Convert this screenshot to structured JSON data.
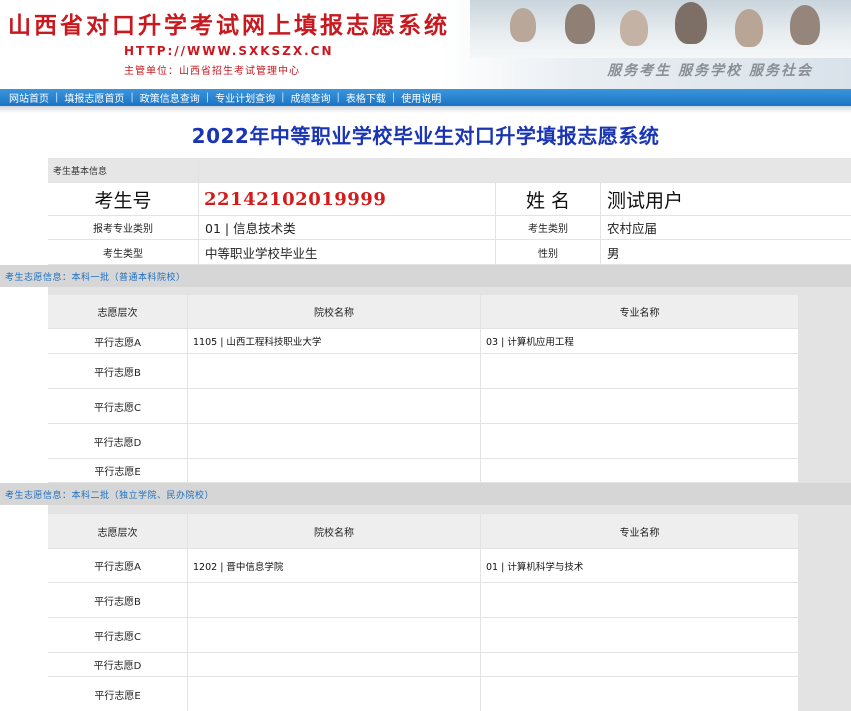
{
  "header": {
    "site_title": "山西省对口升学考试网上填报志愿系统",
    "url": "HTTP://WWW.SXKSZX.CN",
    "org": "主管单位：山西省招生考试管理中心",
    "slogan": "服务考生  服务学校  服务社会"
  },
  "nav": {
    "items": [
      "网站首页",
      "填报志愿首页",
      "政策信息查询",
      "专业计划查询",
      "成绩查询",
      "表格下载",
      "使用说明"
    ]
  },
  "page_title": "2022年中等职业学校毕业生对口升学填报志愿系统",
  "basic_info": {
    "section_label": "考生基本信息",
    "exam_no_label": "考生号",
    "exam_no": "22142102019999",
    "name_label": "姓 名",
    "name": "测试用户",
    "major_cat_label": "报考专业类别",
    "major_cat": "01 | 信息技术类",
    "student_cat_label": "考生类别",
    "student_cat": "农村应届",
    "student_type_label": "考生类型",
    "student_type": "中等职业学校毕业生",
    "gender_label": "性别",
    "gender": "男"
  },
  "batch1": {
    "title": "考生志愿信息：本科一批（普通本科院校）",
    "col_level": "志愿层次",
    "col_school": "院校名称",
    "col_major": "专业名称",
    "rows": [
      {
        "level": "平行志愿A",
        "school": "1105 | 山西工程科技职业大学",
        "major": "03 | 计算机应用工程"
      },
      {
        "level": "平行志愿B",
        "school": "",
        "major": ""
      },
      {
        "level": "平行志愿C",
        "school": "",
        "major": ""
      },
      {
        "level": "平行志愿D",
        "school": "",
        "major": ""
      },
      {
        "level": "平行志愿E",
        "school": "",
        "major": ""
      }
    ]
  },
  "batch2": {
    "title": "考生志愿信息：本科二批（独立学院、民办院校）",
    "col_level": "志愿层次",
    "col_school": "院校名称",
    "col_major": "专业名称",
    "rows": [
      {
        "level": "平行志愿A",
        "school": "1202 | 晋中信息学院",
        "major": "01 | 计算机科学与技术"
      },
      {
        "level": "平行志愿B",
        "school": "",
        "major": ""
      },
      {
        "level": "平行志愿C",
        "school": "",
        "major": ""
      },
      {
        "level": "平行志愿D",
        "school": "",
        "major": ""
      },
      {
        "level": "平行志愿E",
        "school": "",
        "major": ""
      }
    ]
  }
}
